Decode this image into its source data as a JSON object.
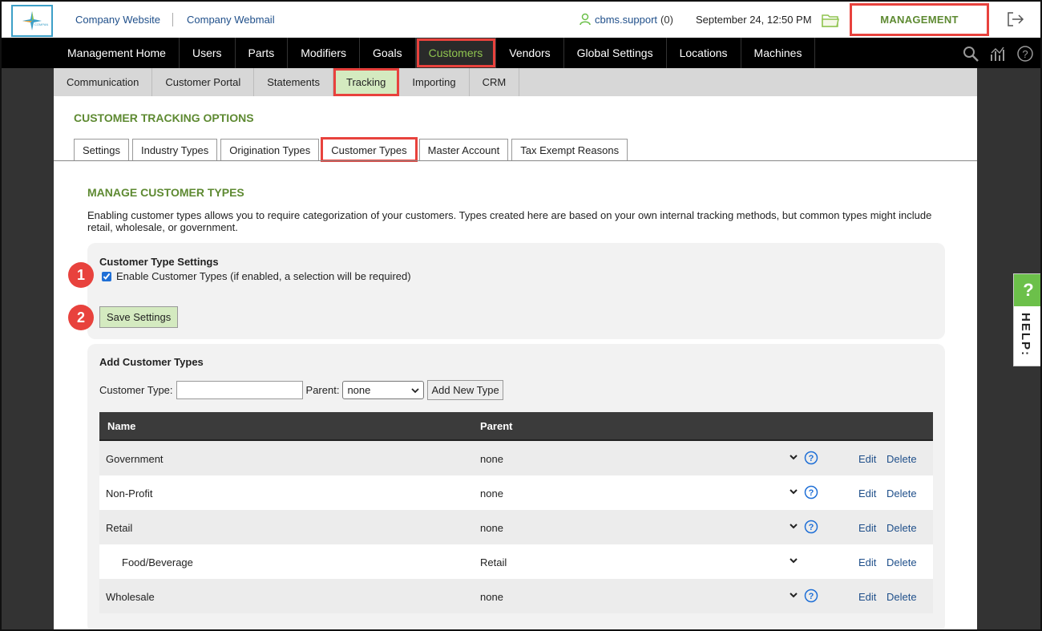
{
  "header": {
    "links": [
      "Company Website",
      "Company Webmail"
    ],
    "user": "cbms.support",
    "user_count": "(0)",
    "datetime": "September 24, 12:50 PM",
    "section": "MANAGEMENT"
  },
  "mainnav": {
    "items": [
      "Management Home",
      "Users",
      "Parts",
      "Modifiers",
      "Goals",
      "Customers",
      "Vendors",
      "Global Settings",
      "Locations",
      "Machines"
    ],
    "active": "Customers"
  },
  "subnav": {
    "items": [
      "Communication",
      "Customer Portal",
      "Statements",
      "Tracking",
      "Importing",
      "CRM"
    ],
    "active": "Tracking"
  },
  "page": {
    "title": "CUSTOMER TRACKING OPTIONS",
    "tabs": [
      "Settings",
      "Industry Types",
      "Origination Types",
      "Customer Types",
      "Master Account",
      "Tax Exempt Reasons"
    ],
    "active_tab": "Customer Types",
    "heading": "MANAGE CUSTOMER TYPES",
    "description": "Enabling customer types allows you to require categorization of your customers. Types created here are based on your own internal tracking methods, but common types might include retail, wholesale, or government."
  },
  "settings": {
    "title": "Customer Type Settings",
    "checkbox_label": "Enable Customer Types (if enabled, a selection will be required)",
    "checked": true,
    "save_label": "Save Settings"
  },
  "add": {
    "title": "Add Customer Types",
    "type_label": "Customer Type:",
    "type_value": "",
    "parent_label": "Parent:",
    "parent_selected": "none",
    "add_label": "Add New Type"
  },
  "table": {
    "headers": [
      "Name",
      "Parent"
    ],
    "rows": [
      {
        "name": "Government",
        "parent": "none",
        "edit": "Edit",
        "delete": "Delete"
      },
      {
        "name": "Non-Profit",
        "parent": "none",
        "edit": "Edit",
        "delete": "Delete"
      },
      {
        "name": "Retail",
        "parent": "none",
        "edit": "Edit",
        "delete": "Delete"
      },
      {
        "name": "Food/Beverage",
        "parent": "Retail",
        "edit": "Edit",
        "delete": "Delete"
      },
      {
        "name": "Wholesale",
        "parent": "none",
        "edit": "Edit",
        "delete": "Delete"
      }
    ]
  },
  "steps": [
    "1",
    "2"
  ],
  "help": {
    "icon": "?",
    "label": "HELP:"
  },
  "colors": {
    "accent_green": "#5e8a32",
    "highlight_red": "#e8423d",
    "link_blue": "#1f4f8a"
  }
}
